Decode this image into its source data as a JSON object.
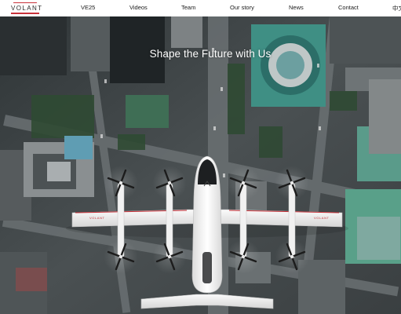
{
  "brand": {
    "logo_text": "VOLANT",
    "accent_color": "#c8323a"
  },
  "nav": {
    "items": [
      {
        "label": "VE25"
      },
      {
        "label": "Videos"
      },
      {
        "label": "Team"
      },
      {
        "label": "Our story"
      },
      {
        "label": "News"
      },
      {
        "label": "Contact"
      },
      {
        "label": "中文"
      }
    ]
  },
  "hero": {
    "headline": "Shape the Future with Us",
    "aircraft_livery": "VOLANT"
  }
}
